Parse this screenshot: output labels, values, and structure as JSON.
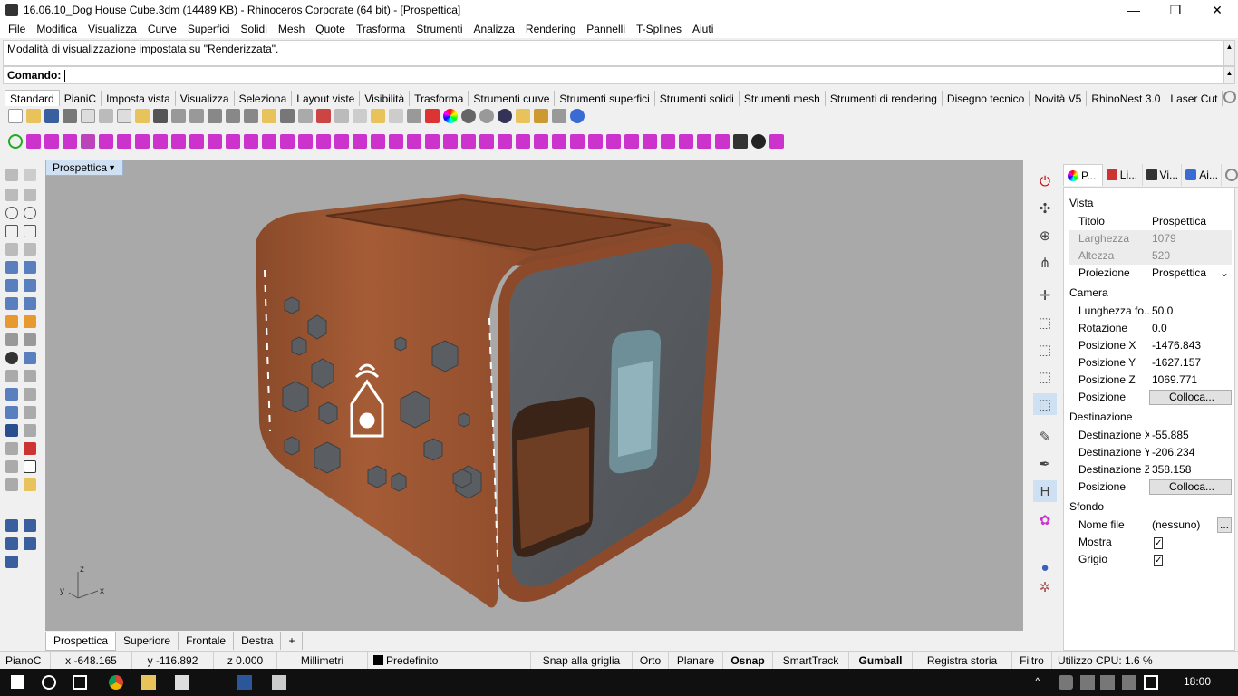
{
  "window": {
    "title": "16.06.10_Dog House Cube.3dm (14489 KB) - Rhinoceros Corporate (64 bit) - [Prospettica]",
    "minimize": "—",
    "restore": "❐",
    "close": "✕"
  },
  "menu": [
    "File",
    "Modifica",
    "Visualizza",
    "Curve",
    "Superfici",
    "Solidi",
    "Mesh",
    "Quote",
    "Trasforma",
    "Strumenti",
    "Analizza",
    "Rendering",
    "Pannelli",
    "T-Splines",
    "Aiuti"
  ],
  "command": {
    "history": "Modalità di visualizzazione impostata su \"Renderizzata\".",
    "prompt": "Comando:"
  },
  "toolbar_tabs": [
    "Standard",
    "PianiC",
    "Imposta vista",
    "Visualizza",
    "Seleziona",
    "Layout viste",
    "Visibilità",
    "Trasforma",
    "Strumenti curve",
    "Strumenti superfici",
    "Strumenti solidi",
    "Strumenti mesh",
    "Strumenti di rendering",
    "Disegno tecnico",
    "Novità V5",
    "RhinoNest 3.0",
    "Laser Cut"
  ],
  "viewport": {
    "title": "Prospettica",
    "tabs": [
      "Prospettica",
      "Superiore",
      "Frontale",
      "Destra"
    ],
    "add_tab": "+",
    "axis": {
      "x": "x",
      "y": "y",
      "z": "z"
    }
  },
  "panel": {
    "tabs": [
      "P...",
      "Li...",
      "Vi...",
      "Ai..."
    ],
    "sections": {
      "vista": "Vista",
      "camera": "Camera",
      "destinazione": "Destinazione",
      "sfondo": "Sfondo"
    },
    "vista_rows": [
      {
        "k": "Titolo",
        "v": "Prospettica"
      },
      {
        "k": "Larghezza",
        "v": "1079"
      },
      {
        "k": "Altezza",
        "v": "520"
      },
      {
        "k": "Proiezione",
        "v": "Prospettica"
      }
    ],
    "camera_rows": [
      {
        "k": "Lunghezza fo...",
        "v": "50.0"
      },
      {
        "k": "Rotazione",
        "v": "0.0"
      },
      {
        "k": "Posizione X",
        "v": "-1476.843"
      },
      {
        "k": "Posizione Y",
        "v": "-1627.157"
      },
      {
        "k": "Posizione Z",
        "v": "1069.771"
      },
      {
        "k": "Posizione",
        "v": "Colloca..."
      }
    ],
    "dest_rows": [
      {
        "k": "Destinazione X",
        "v": "-55.885"
      },
      {
        "k": "Destinazione Y",
        "v": "-206.234"
      },
      {
        "k": "Destinazione Z",
        "v": "358.158"
      },
      {
        "k": "Posizione",
        "v": "Colloca..."
      }
    ],
    "sfondo_rows": [
      {
        "k": "Nome file",
        "v": "(nessuno)",
        "btn": "..."
      },
      {
        "k": "Mostra",
        "v": "✓"
      },
      {
        "k": "Grigio",
        "v": "✓"
      }
    ]
  },
  "status": {
    "plane": "PianoC",
    "x": "x -648.165",
    "y": "y -116.892",
    "z": "z 0.000",
    "units": "Millimetri",
    "layer": "Predefinito",
    "snap": "Snap alla griglia",
    "orto": "Orto",
    "planare": "Planare",
    "osnap": "Osnap",
    "smarttrack": "SmartTrack",
    "gumball": "Gumball",
    "history": "Registra storia",
    "filtro": "Filtro",
    "cpu": "Utilizzo CPU: 1.6 %"
  },
  "taskbar": {
    "clock": "18:00"
  },
  "colors": {
    "wood": "#9c5532",
    "viewport_bg": "#a9a9a9",
    "panel_bg": "#5a5e63"
  }
}
